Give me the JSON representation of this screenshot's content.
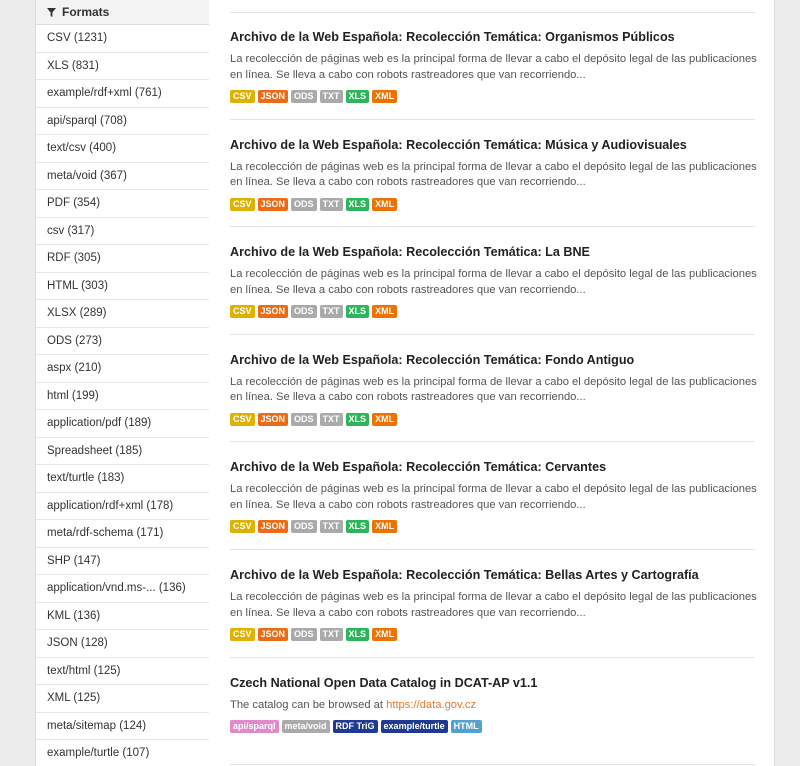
{
  "sidebar": {
    "heading": "Formats",
    "items": [
      "CSV (1231)",
      "XLS (831)",
      "example/rdf+xml (761)",
      "api/sparql (708)",
      "text/csv (400)",
      "meta/void (367)",
      "PDF (354)",
      "csv (317)",
      "RDF (305)",
      "HTML (303)",
      "XLSX (289)",
      "ODS (273)",
      "aspx (210)",
      "html (199)",
      "application/pdf (189)",
      "Spreadsheet (185)",
      "text/turtle (183)",
      "application/rdf+xml (178)",
      "meta/rdf-schema (171)",
      "SHP (147)",
      "application/vnd.ms-... (136)",
      "KML (136)",
      "JSON (128)",
      "text/html (125)",
      "XML (125)",
      "meta/sitemap (124)",
      "example/turtle (107)"
    ]
  },
  "datasets": [
    {
      "title": "Archivo de la Web Española: Recolección Temática: Organismos Públicos",
      "desc": "La recolección de páginas web es la principal forma de llevar a cabo el depósito legal de las publicaciones en línea. Se lleva a cabo con robots rastreadores que van recorriendo...",
      "formats": [
        "CSV",
        "JSON",
        "ODS",
        "TXT",
        "XLS",
        "XML"
      ]
    },
    {
      "title": "Archivo de la Web Española: Recolección Temática: Música y Audiovisuales",
      "desc": "La recolección de páginas web es la principal forma de llevar a cabo el depósito legal de las publicaciones en línea. Se lleva a cabo con robots rastreadores que van recorriendo...",
      "formats": [
        "CSV",
        "JSON",
        "ODS",
        "TXT",
        "XLS",
        "XML"
      ]
    },
    {
      "title": "Archivo de la Web Española: Recolección Temática: La BNE",
      "desc": "La recolección de páginas web es la principal forma de llevar a cabo el depósito legal de las publicaciones en línea. Se lleva a cabo con robots rastreadores que van recorriendo...",
      "formats": [
        "CSV",
        "JSON",
        "ODS",
        "TXT",
        "XLS",
        "XML"
      ]
    },
    {
      "title": "Archivo de la Web Española: Recolección Temática: Fondo Antiguo",
      "desc": "La recolección de páginas web es la principal forma de llevar a cabo el depósito legal de las publicaciones en línea. Se lleva a cabo con robots rastreadores que van recorriendo...",
      "formats": [
        "CSV",
        "JSON",
        "ODS",
        "TXT",
        "XLS",
        "XML"
      ]
    },
    {
      "title": "Archivo de la Web Española: Recolección Temática: Cervantes",
      "desc": "La recolección de páginas web es la principal forma de llevar a cabo el depósito legal de las publicaciones en línea. Se lleva a cabo con robots rastreadores que van recorriendo...",
      "formats": [
        "CSV",
        "JSON",
        "ODS",
        "TXT",
        "XLS",
        "XML"
      ]
    },
    {
      "title": "Archivo de la Web Española: Recolección Temática: Bellas Artes y Cartografía",
      "desc": "La recolección de páginas web es la principal forma de llevar a cabo el depósito legal de las publicaciones en línea. Se lleva a cabo con robots rastreadores que van recorriendo...",
      "formats": [
        "CSV",
        "JSON",
        "ODS",
        "TXT",
        "XLS",
        "XML"
      ]
    },
    {
      "title": "Czech National Open Data Catalog in DCAT-AP v1.1",
      "desc": "The catalog can be browsed at",
      "link": "https://data.gov.cz",
      "formats": [
        "api/sparql",
        "meta/void",
        "RDF TriG",
        "example/turtle",
        "HTML"
      ]
    }
  ],
  "format_colors": {
    "CSV": "#dfb100",
    "JSON": "#ec6b16",
    "ODS": "#aaaaaa",
    "TXT": "#aaaaaa",
    "XLS": "#2db55d",
    "XML": "#ef7100",
    "api/sparql": "#e08acb",
    "meta/void": "#aaaaaa",
    "RDF TriG": "#1f3a93",
    "example/turtle": "#1f3a93",
    "HTML": "#55a1ce"
  },
  "icons": {
    "filter": "filter-icon"
  }
}
